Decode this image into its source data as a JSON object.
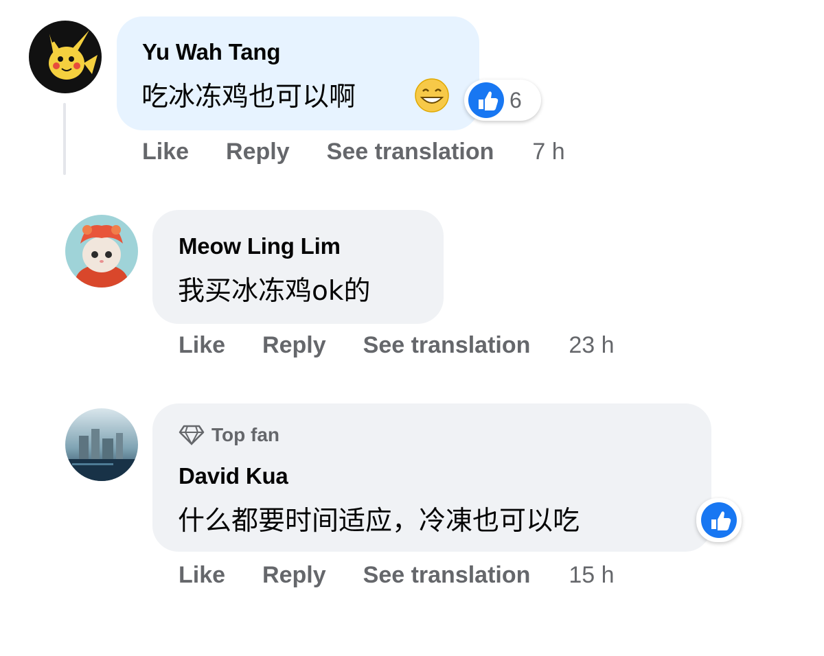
{
  "comments": [
    {
      "author": "Yu Wah Tang",
      "text": "吃冰冻鸡也可以啊",
      "emoji": "grinning-face-icon",
      "reaction_count": "6",
      "actions": {
        "like": "Like",
        "reply": "Reply",
        "translate": "See translation"
      },
      "time": "7 h"
    },
    {
      "author": "Meow Ling Lim",
      "text": "我买冰冻鸡ok的",
      "actions": {
        "like": "Like",
        "reply": "Reply",
        "translate": "See translation"
      },
      "time": "23 h"
    },
    {
      "badge": "Top fan",
      "author": "David Kua",
      "text": "什么都要时间适应，冷凍也可以吃",
      "actions": {
        "like": "Like",
        "reply": "Reply",
        "translate": "See translation"
      },
      "time": "15 h"
    }
  ],
  "colors": {
    "bubble_highlight": "#e7f3ff",
    "bubble": "#f0f2f5",
    "secondary_text": "#65676b",
    "like_blue": "#1877f2"
  }
}
